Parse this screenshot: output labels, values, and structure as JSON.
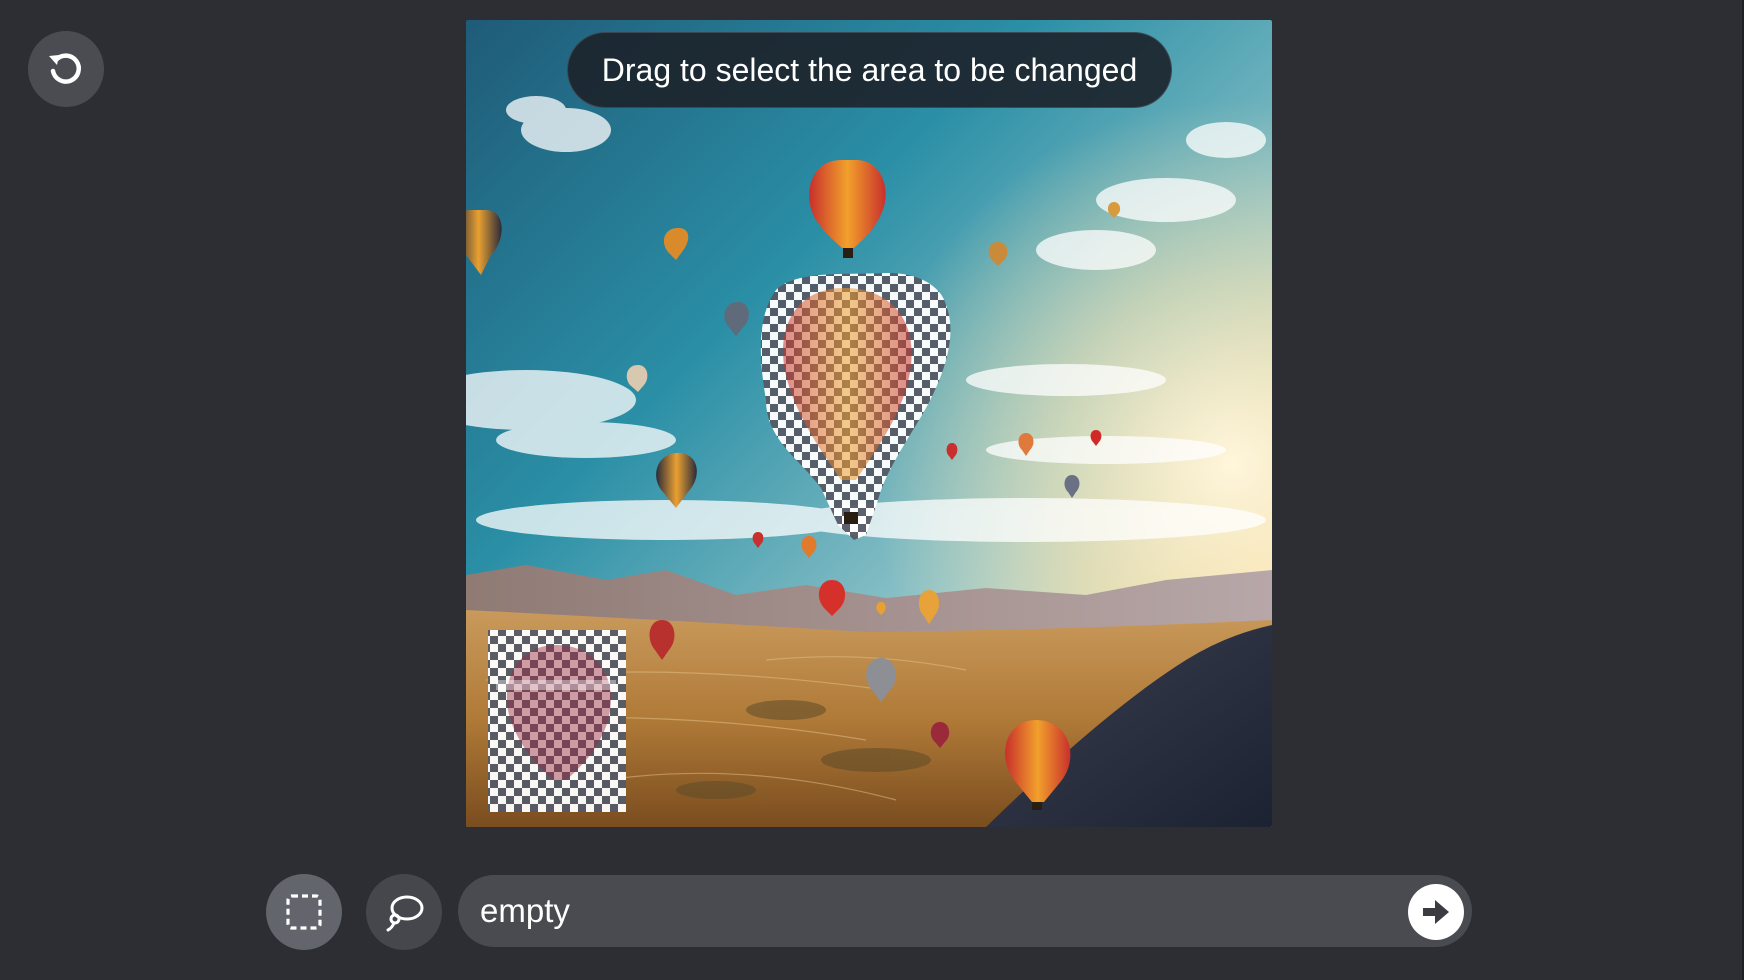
{
  "toolbar": {
    "undo_icon": "undo-icon",
    "rect_select_icon": "rectangle-select-icon",
    "lasso_select_icon": "lasso-select-icon"
  },
  "canvas": {
    "hint_text": "Drag to select the area to be changed",
    "image_subject": "hot air balloons over a desert valley at sunset"
  },
  "prompt": {
    "value": "empty",
    "send_icon": "arrow-right-icon"
  },
  "colors": {
    "background": "#2d2e33",
    "button": "#4a4c52",
    "active_tool": "#63656c",
    "prompt_bar": "#494b51"
  }
}
